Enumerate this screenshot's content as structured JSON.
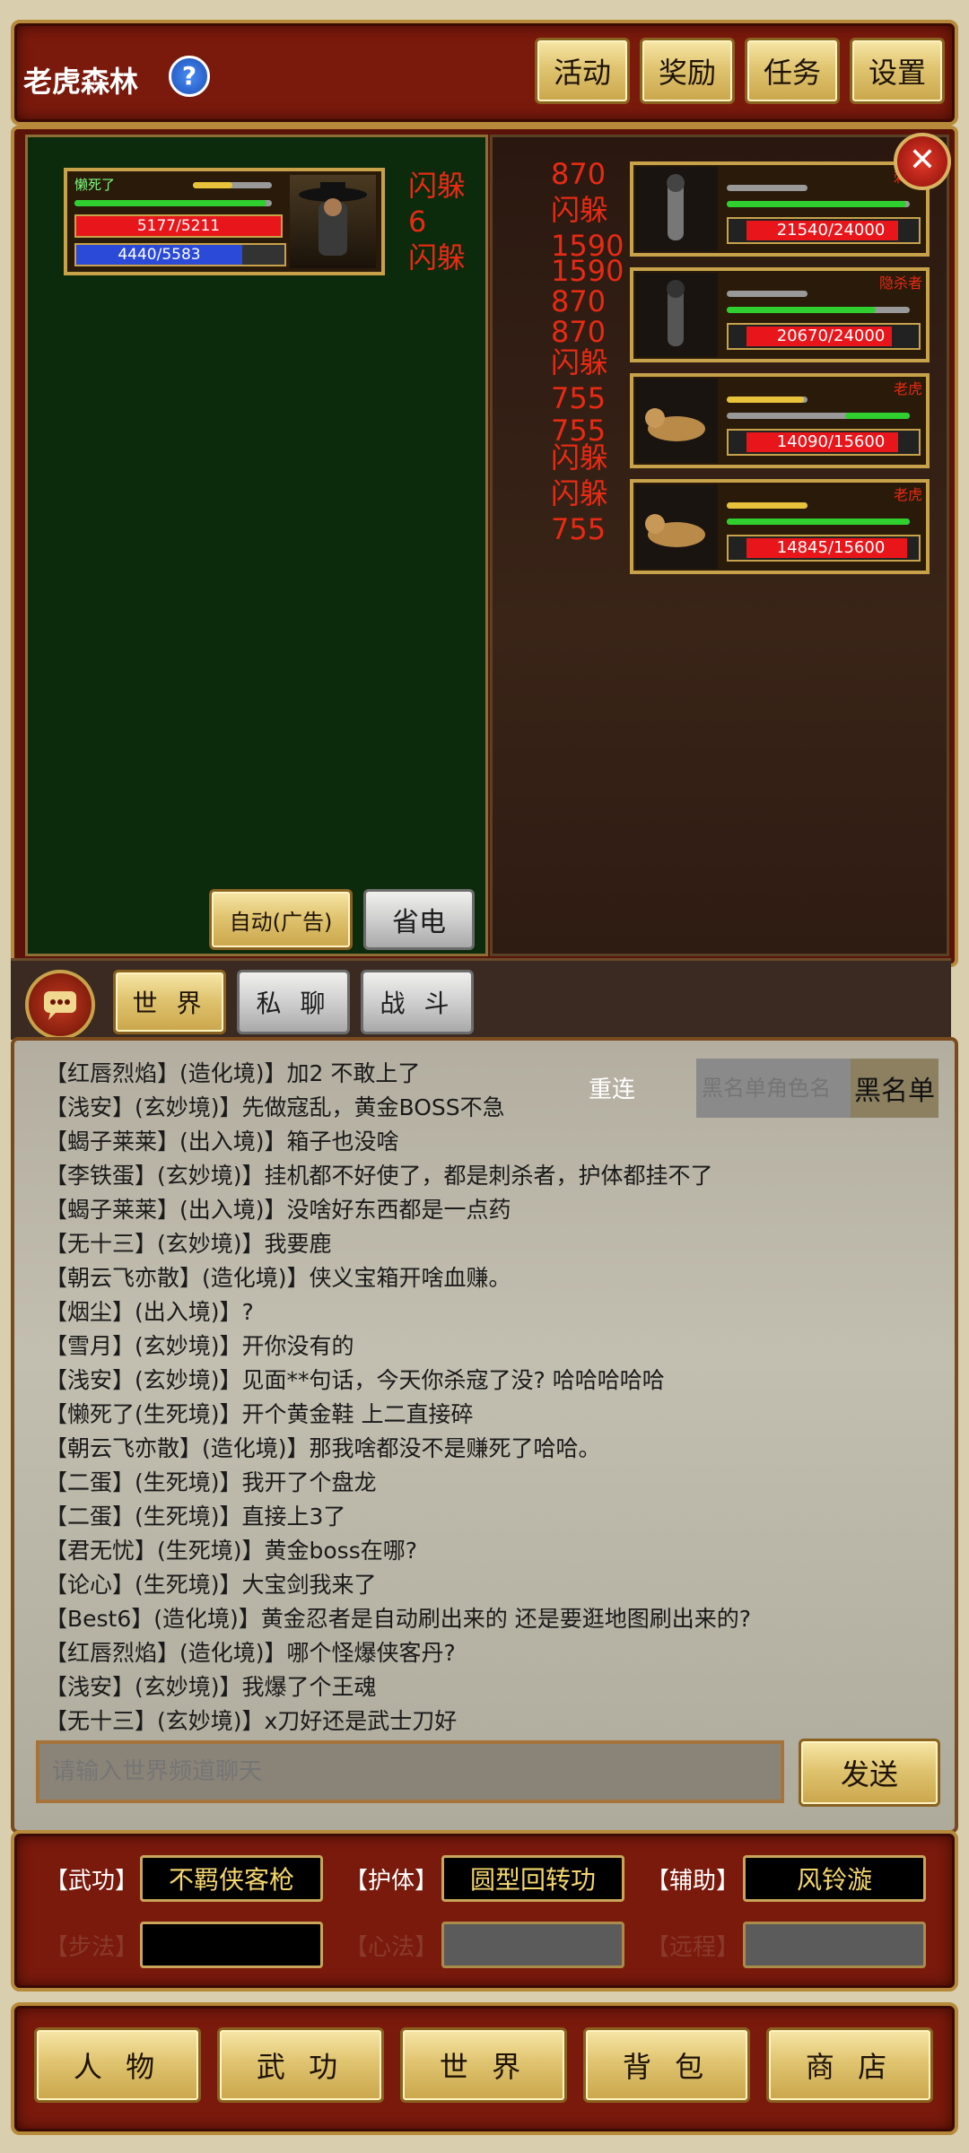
{
  "location": {
    "name": "老虎森林"
  },
  "top_menu": [
    "活动",
    "奖励",
    "任务",
    "设置"
  ],
  "player": {
    "name": "懒死了",
    "hp": "5177/5211",
    "mp": "4440/5583"
  },
  "player_floats": [
    "闪躲",
    "6",
    "闪躲"
  ],
  "enemy_floats": [
    "870",
    "闪躲",
    "1590",
    "1590",
    "870",
    "870",
    "闪躲",
    "755",
    "755",
    "闪躲",
    "闪躲",
    "755"
  ],
  "enemies": [
    {
      "name": "刺客",
      "hp": "21540/24000",
      "hp_fraction": 0.9,
      "portrait": "assassin-portrait"
    },
    {
      "name": "隐杀者",
      "hp": "20670/24000",
      "hp_fraction": 0.86,
      "portrait": "hidden-killer-portrait"
    },
    {
      "name": "老虎",
      "hp": "14090/15600",
      "hp_fraction": 0.9,
      "portrait": "tiger-portrait"
    },
    {
      "name": "老虎",
      "hp": "14845/15600",
      "hp_fraction": 0.95,
      "portrait": "tiger-portrait"
    }
  ],
  "battle_buttons": {
    "auto": "自动(广告)",
    "power_save": "省电"
  },
  "chat_tabs": [
    "世 界",
    "私 聊",
    "战 斗"
  ],
  "chat_controls": {
    "reconnect": "重连",
    "blacklist_placeholder": "黑名单角色名",
    "blacklist_button": "黑名单"
  },
  "chat_messages": [
    "【红唇烈焰】(造化境)】加2 不敢上了",
    "【浅安】(玄妙境)】先做寇乱，黄金BOSS不急",
    "【蝎子莱莱】(出入境)】箱子也没啥",
    "【李铁蛋】(玄妙境)】挂机都不好使了，都是刺杀者，护体都挂不了",
    "【蝎子莱莱】(出入境)】没啥好东西都是一点药",
    "【无十三】(玄妙境)】我要鹿",
    "【朝云飞亦散】(造化境)】侠义宝箱开啥血赚。",
    "【烟尘】(出入境)】?",
    "【雪月】(玄妙境)】开你没有的",
    "【浅安】(玄妙境)】见面**句话，今天你杀寇了没? 哈哈哈哈哈",
    "【懒死了(生死境)】开个黄金鞋 上二直接碎",
    "【朝云飞亦散】(造化境)】那我啥都没不是赚死了哈哈。",
    "【二蛋】(生死境)】我开了个盘龙",
    "【二蛋】(生死境)】直接上3了",
    "【君无忧】(生死境)】黄金boss在哪?",
    "【论心】(生死境)】大宝剑我来了",
    "【Best6】(造化境)】黄金忍者是自动刷出来的 还是要逛地图刷出来的?",
    "【红唇烈焰】(造化境)】哪个怪爆侠客丹?",
    "【浅安】(玄妙境)】我爆了个王魂",
    "【无十三】(玄妙境)】x刀好还是武士刀好"
  ],
  "chat_input": {
    "placeholder": "请输入世界频道聊天",
    "send": "发送"
  },
  "skills": {
    "row1": [
      {
        "label": "【武功】",
        "value": "不羁侠客枪"
      },
      {
        "label": "【护体】",
        "value": "圆型回转功"
      },
      {
        "label": "【辅助】",
        "value": "风铃漩"
      }
    ],
    "row2": [
      {
        "label": "【步法】",
        "value": ""
      },
      {
        "label": "【心法】",
        "value": ""
      },
      {
        "label": "【远程】",
        "value": ""
      }
    ]
  },
  "bottom_nav": [
    "人 物",
    "武 功",
    "世 界",
    "背 包",
    "商 店"
  ],
  "colors": {
    "frame_red": "#7a1a0c",
    "gold": "#e0c470",
    "hp_red": "#e8161b",
    "mp_blue": "#2b4ad8",
    "damage_red": "#e62b14"
  }
}
